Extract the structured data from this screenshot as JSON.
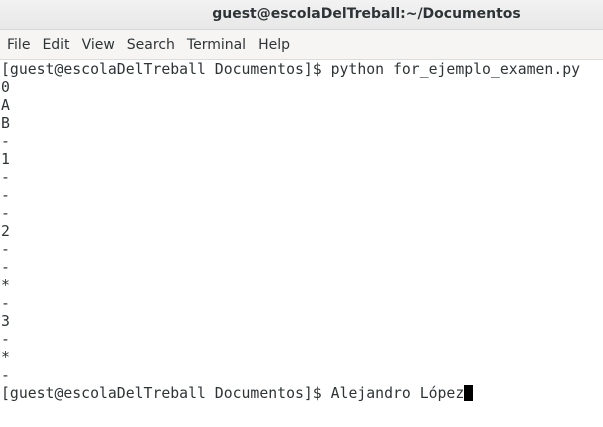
{
  "window": {
    "title": "guest@escolaDelTreball:~/Documentos"
  },
  "menu": [
    "File",
    "Edit",
    "View",
    "Search",
    "Terminal",
    "Help"
  ],
  "terminal": {
    "lines": [
      "[guest@escolaDelTreball Documentos]$ python for_ejemplo_examen.py",
      "0",
      "A",
      "B",
      "-",
      "1",
      "-",
      "-",
      "-",
      "2",
      "-",
      "-",
      "*",
      "-",
      "3",
      "-",
      "*",
      "-"
    ],
    "prompt": "[guest@escolaDelTreball Documentos]$ ",
    "input": "Alejandro López"
  },
  "colors": {
    "text": "#2e3436",
    "background": "#ffffff",
    "cursor": "#000000"
  }
}
